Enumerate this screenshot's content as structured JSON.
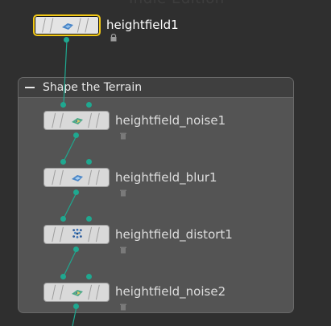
{
  "background_text": "Indie Edition",
  "colors": {
    "wire": "#1fa890",
    "selected_outline": "#f2c816",
    "network_box": "#545454"
  },
  "network_box": {
    "title": "Shape the Terrain",
    "collapse_icon": "minus-icon"
  },
  "nodes": [
    {
      "name": "heightfield1",
      "selected": true,
      "sub_icon": "lock-icon",
      "thumbnail": "terrain-icon"
    },
    {
      "name": "heightfield_noise1",
      "selected": false,
      "sub_icon": "trash-icon",
      "thumbnail": "terrain-noise-icon"
    },
    {
      "name": "heightfield_blur1",
      "selected": false,
      "sub_icon": "trash-icon",
      "thumbnail": "terrain-blur-icon"
    },
    {
      "name": "heightfield_distort1",
      "selected": false,
      "sub_icon": "trash-icon",
      "thumbnail": "terrain-distort-icon"
    },
    {
      "name": "heightfield_noise2",
      "selected": false,
      "sub_icon": "trash-icon",
      "thumbnail": "terrain-noise-icon"
    }
  ]
}
